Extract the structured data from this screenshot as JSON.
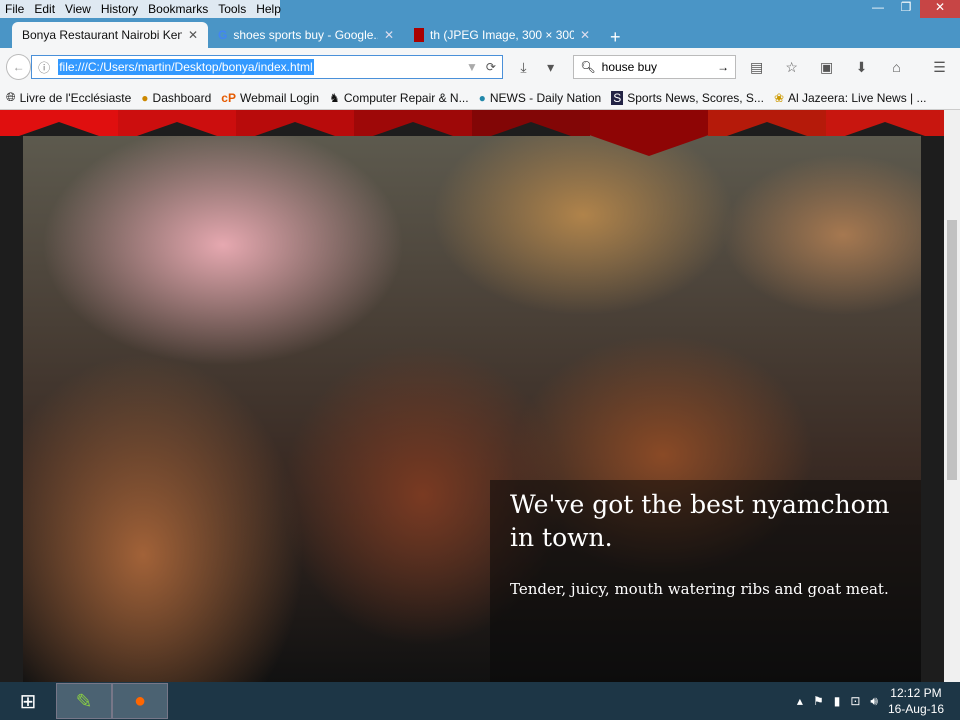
{
  "menu": [
    "File",
    "Edit",
    "View",
    "History",
    "Bookmarks",
    "Tools",
    "Help"
  ],
  "tabs": [
    {
      "title": "Bonya Restaurant Nairobi Ken..."
    },
    {
      "title": "shoes sports buy - Google..."
    },
    {
      "title": "th (JPEG Image, 300 × 300 ..."
    }
  ],
  "url": "file:///C:/Users/martin/Desktop/bonya/index.html",
  "search": "house buy",
  "bookmarks": [
    "Livre de l'Ecclésiaste",
    "Dashboard",
    "Webmail Login",
    "Computer Repair & N...",
    "NEWS - Daily Nation",
    "Sports News, Scores, S...",
    "Al Jazeera: Live News | ..."
  ],
  "hero": {
    "heading": "We've got the best nyamchom in town.",
    "text": "Tender, juicy, mouth watering ribs and goat meat."
  },
  "clock": {
    "time": "12:12 PM",
    "date": "16-Aug-16"
  },
  "banner_colors": [
    "#e00f0f",
    "#cc0e0e",
    "#b80b0b",
    "#9e0808",
    "#820606",
    "#8e0505",
    "#b51a0a",
    "#c8160f"
  ]
}
